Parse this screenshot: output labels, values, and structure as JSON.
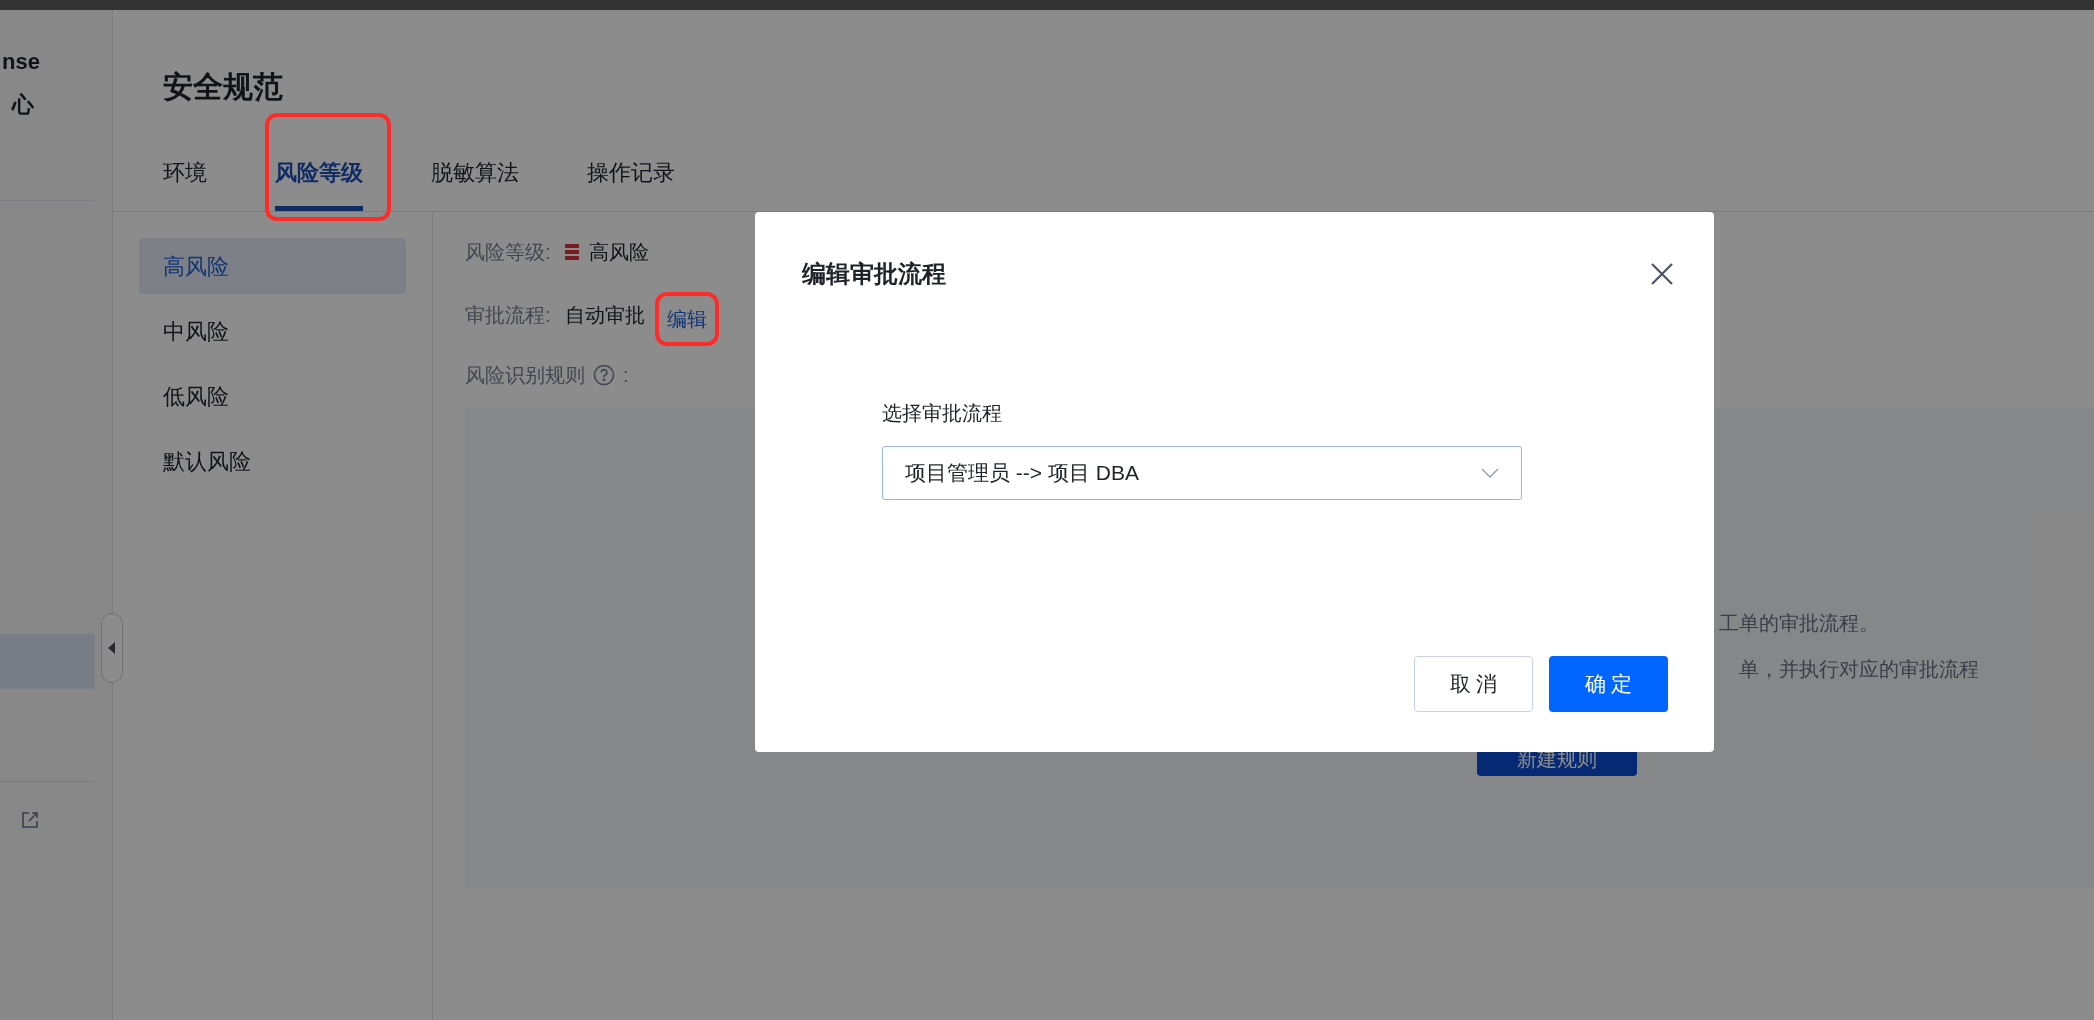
{
  "sidebar": {
    "texts": [
      "nse",
      "心"
    ]
  },
  "page": {
    "title": "安全规范",
    "tabs": [
      {
        "label": "环境",
        "selected": false
      },
      {
        "label": "风险等级",
        "selected": true
      },
      {
        "label": "脱敏算法",
        "selected": false
      },
      {
        "label": "操作记录",
        "selected": false
      }
    ],
    "levels": [
      {
        "label": "高风险",
        "selected": true
      },
      {
        "label": "中风险",
        "selected": false
      },
      {
        "label": "低风险",
        "selected": false
      },
      {
        "label": "默认风险",
        "selected": false
      }
    ],
    "detail": {
      "level_label": "风险等级:",
      "level_value": "高风险",
      "flow_label": "审批流程:",
      "flow_value": "自动审批",
      "edit_link": "编辑",
      "rules_label": "风险识别规则",
      "rules_colon": ":",
      "empty_lines": [
        "工单的审批流程。",
        "单，并执行对应的审批流程"
      ],
      "new_rule_button": "新建规则"
    }
  },
  "dialog": {
    "title": "编辑审批流程",
    "field_label": "选择审批流程",
    "select_value": "项目管理员 --> 项目 DBA",
    "buttons": [
      {
        "label": "取 消",
        "kind": "secondary"
      },
      {
        "label": "确 定",
        "kind": "primary"
      }
    ]
  }
}
